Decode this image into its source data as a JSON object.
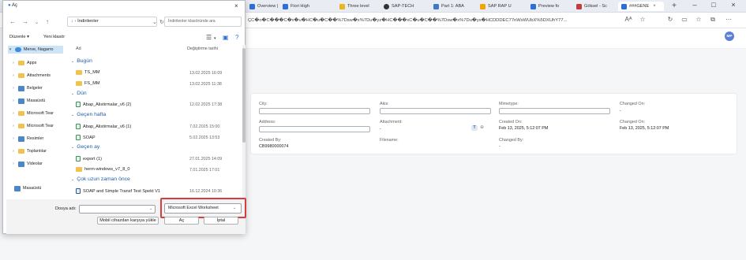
{
  "browser": {
    "tabs": [
      {
        "label": "Overview |",
        "color": "#2d6fd6"
      },
      {
        "label": "Fiori High",
        "color": "#2d6fd6"
      },
      {
        "label": "Three level",
        "color": "#e8b51a"
      },
      {
        "label": "SAP-TECH",
        "color": "#333333"
      },
      {
        "label": "Part 1: ABA",
        "color": "#4177c3"
      },
      {
        "label": "SAP RAP U",
        "color": "#f0a500"
      },
      {
        "label": "Preview fo",
        "color": "#2d6fd6"
      },
      {
        "label": "Göksel - Sc",
        "color": "#c43b3b"
      },
      {
        "label": "###GENE",
        "color": "#2d6fd6"
      }
    ],
    "url": "ÇC�o�C���C�x�u�HC�u�C��%7Dsw�x%7Du�yz�HC���xC�u�C��%7Dsw�x%7Du�ys�HCDDDEC77nWsWUbX%5DXUhY77..."
  },
  "app": {
    "avatar": "MP",
    "fields": {
      "city": "City:",
      "akis": "Akis:",
      "mimetype": "Mimetype:",
      "changed_on_1": "Changed On:",
      "changed_on_1_value": "-",
      "address": "Address:",
      "attachment": "Attachment:",
      "attachment_value": "-",
      "created_on": "Created On:",
      "created_on_value": "Feb 13, 2025, 5:12:07 PM",
      "changed_on_2": "Changed On:",
      "changed_on_2_value": "Feb 13, 2025, 5:12:07 PM",
      "created_by": "Created By:",
      "created_by_value": "CB9980000074",
      "filename": "Filename:",
      "changed_by": "Changed By:",
      "changed_by_value": "-",
      "upload_btn": "T"
    }
  },
  "dialog": {
    "title": "Aç",
    "path": "İndirilenler",
    "search_placeholder": "İndirilenler klasöründe ara",
    "organize": "Düzenle",
    "new_folder": "Yeni klasör",
    "col_name": "Ad",
    "col_date": "Değiştirme tarihi",
    "nav": [
      {
        "label": "Merve, Nagarro",
        "icon": "onedrive-icon",
        "selected": true
      },
      {
        "label": "Apps",
        "icon": "folder-icon"
      },
      {
        "label": "Attachments",
        "icon": "folder-icon"
      },
      {
        "label": "Belgeler",
        "icon": "documents-icon"
      },
      {
        "label": "Masaüstü",
        "icon": "desktop-icon"
      },
      {
        "label": "Microsoft Tear",
        "icon": "folder-icon"
      },
      {
        "label": "Microsoft Tear",
        "icon": "folder-icon"
      },
      {
        "label": "Resimler",
        "icon": "pictures-icon"
      },
      {
        "label": "Toplantılar",
        "icon": "folder-icon"
      },
      {
        "label": "Videolar",
        "icon": "videos-icon"
      },
      {
        "label": "Masaüstü",
        "icon": "desktop-icon"
      }
    ],
    "groups": [
      {
        "label": "Bugün",
        "files": [
          {
            "name": "TS_MM",
            "date": "13.02.2025 16:09",
            "icon": "folder"
          },
          {
            "name": "FS_MM",
            "date": "13.02.2025 11:38",
            "icon": "folder"
          }
        ]
      },
      {
        "label": "Dün",
        "files": [
          {
            "name": "Abap_Alistirmalar_v6 (2)",
            "date": "12.02.2025 17:38",
            "icon": "file"
          }
        ]
      },
      {
        "label": "Geçen hafta",
        "files": [
          {
            "name": "Abap_Alistirmalar_v6 (1)",
            "date": "7.02.2025 15:00",
            "icon": "file"
          },
          {
            "name": "SOAP",
            "date": "5.02.2025 13:53",
            "icon": "file"
          }
        ]
      },
      {
        "label": "Geçen ay",
        "files": [
          {
            "name": "export (1)",
            "date": "27.01.2025 14:09",
            "icon": "file"
          },
          {
            "name": "herm-windows_v7_8_0",
            "date": "7.01.2025 17:01",
            "icon": "folder"
          }
        ]
      },
      {
        "label": "Çok uzun zaman önce",
        "files": [
          {
            "name": "SOAP and Simple Transf Test Spekt V1",
            "date": "16.12.2024 10:36",
            "icon": "file"
          }
        ]
      }
    ],
    "filename_label": "Dosya adı:",
    "filename_value": "",
    "filetype": "Microsoft Excel Worksheet",
    "mobile_btn": "Mobil cihazdan karşıya yükle",
    "open_btn": "Aç",
    "cancel_btn": "İptal"
  }
}
